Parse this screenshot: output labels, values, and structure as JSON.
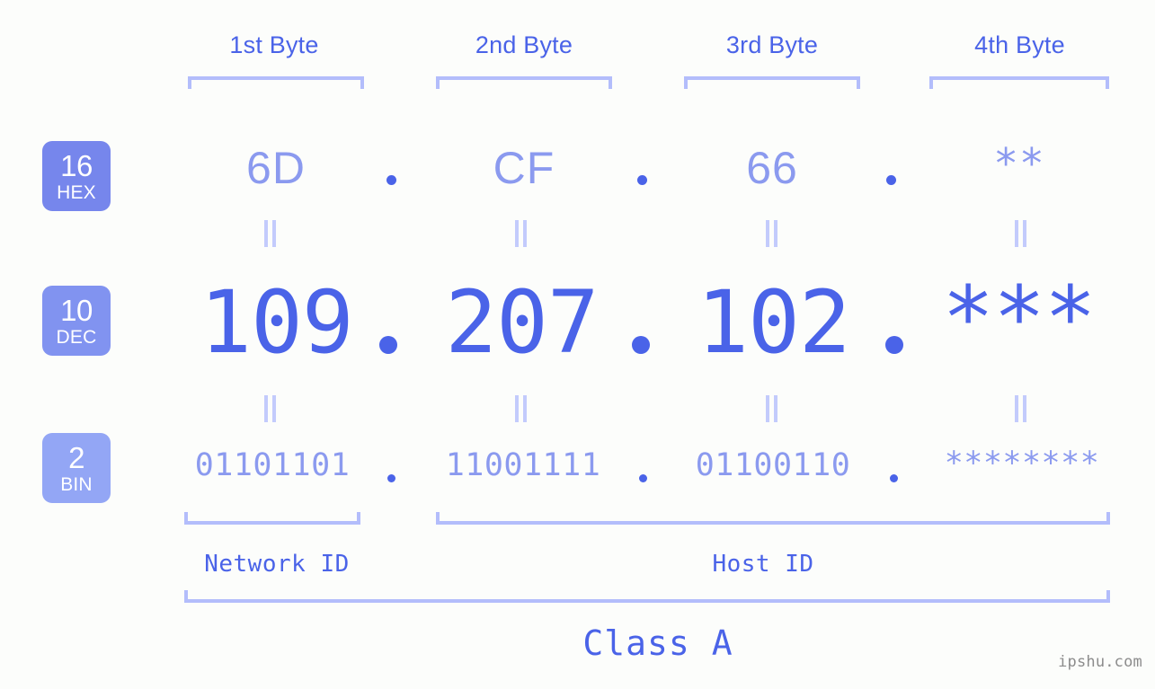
{
  "meta": {
    "watermark": "ipshu.com",
    "background_color": "#fcfdfb",
    "accent_color": "#4a63e8",
    "light_accent_color": "#8b9aef",
    "bracket_color": "#b3bdfb"
  },
  "byte_headers": [
    {
      "label": "1st Byte"
    },
    {
      "label": "2nd Byte"
    },
    {
      "label": "3rd Byte"
    },
    {
      "label": "4th Byte"
    }
  ],
  "bases": [
    {
      "number": "16",
      "name": "HEX",
      "color": "#7686ec"
    },
    {
      "number": "10",
      "name": "DEC",
      "color": "#8193f0"
    },
    {
      "number": "2",
      "name": "BIN",
      "color": "#93a6f5"
    }
  ],
  "rows": {
    "hex": {
      "base_number": "16",
      "base_name": "HEX",
      "values": [
        "6D",
        "CF",
        "66",
        "**"
      ],
      "separator": "."
    },
    "dec": {
      "base_number": "10",
      "base_name": "DEC",
      "values": [
        "109",
        "207",
        "102",
        "***"
      ],
      "separator": "."
    },
    "bin": {
      "base_number": "2",
      "base_name": "BIN",
      "values": [
        "01101101",
        "11001111",
        "01100110",
        "********"
      ],
      "separator": "."
    }
  },
  "equals_symbol": "=",
  "ids": {
    "network": "Network ID",
    "host": "Host ID"
  },
  "class": {
    "label": "Class A"
  },
  "chart_data": {
    "type": "table",
    "title": "IP address byte breakdown",
    "categories": [
      "1st Byte",
      "2nd Byte",
      "3rd Byte",
      "4th Byte"
    ],
    "series": [
      {
        "name": "HEX",
        "values": [
          "6D",
          "CF",
          "66",
          "**"
        ]
      },
      {
        "name": "DEC",
        "values": [
          "109",
          "207",
          "102",
          "***"
        ]
      },
      {
        "name": "BIN",
        "values": [
          "01101101",
          "11001111",
          "01100110",
          "********"
        ]
      }
    ],
    "groupings": [
      {
        "name": "Network ID",
        "bytes": [
          1
        ]
      },
      {
        "name": "Host ID",
        "bytes": [
          2,
          3,
          4
        ]
      },
      {
        "name": "Class A",
        "bytes": [
          1,
          2,
          3,
          4
        ]
      }
    ]
  }
}
